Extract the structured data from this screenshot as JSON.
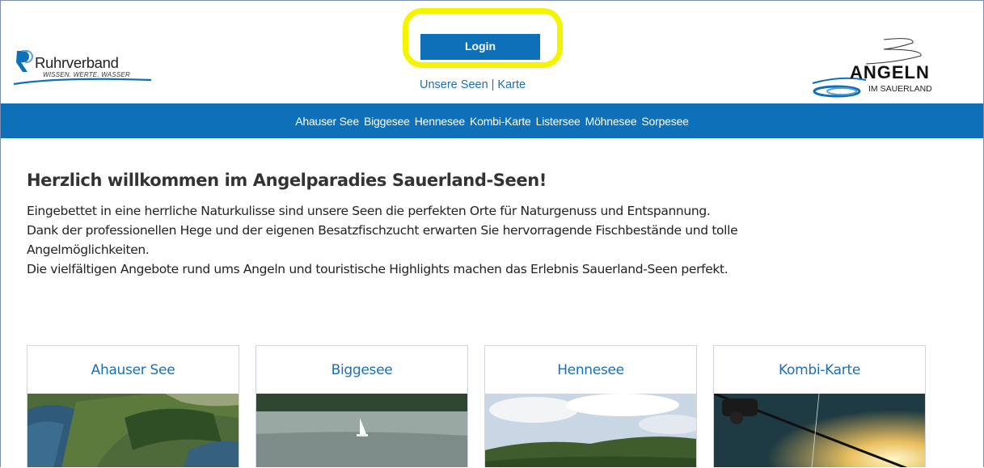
{
  "header": {
    "logo_left": {
      "name": "Ruhrverband",
      "tagline": "WISSEN. WERTE. WASSER"
    },
    "login_label": "Login",
    "links": [
      {
        "label": "Unsere Seen"
      },
      {
        "label": "Karte"
      }
    ],
    "logo_right": {
      "word": "ANGELN",
      "sub": "IM SAUERLAND"
    }
  },
  "nav": {
    "items": [
      {
        "label": "Ahauser See"
      },
      {
        "label": "Biggesee"
      },
      {
        "label": "Hennesee"
      },
      {
        "label": "Kombi-Karte"
      },
      {
        "label": "Listersee"
      },
      {
        "label": "Möhnesee"
      },
      {
        "label": "Sorpesee"
      }
    ]
  },
  "main": {
    "heading": "Herzlich willkommen im Angelparadies Sauerland-Seen!",
    "intro_lines": [
      "Eingebettet in eine herrliche Naturkulisse sind unsere Seen die perfekten Orte für Naturgenuss und Entspannung.",
      "Dank der professionellen Hege und der eigenen Besatzfischzucht erwarten Sie hervorragende Fischbestände und tolle",
      "Angelmöglichkeiten.",
      "Die vielfältigen Angebote rund ums Angeln und touristische Highlights machen das Erlebnis Sauerland-Seen perfekt."
    ]
  },
  "cards": [
    {
      "title": "Ahauser See"
    },
    {
      "title": "Biggesee"
    },
    {
      "title": "Hennesee"
    },
    {
      "title": "Kombi-Karte"
    }
  ],
  "colors": {
    "brand_blue": "#0d70b8",
    "link_blue": "#1a6fb8",
    "highlight_yellow": "#f5f400"
  }
}
